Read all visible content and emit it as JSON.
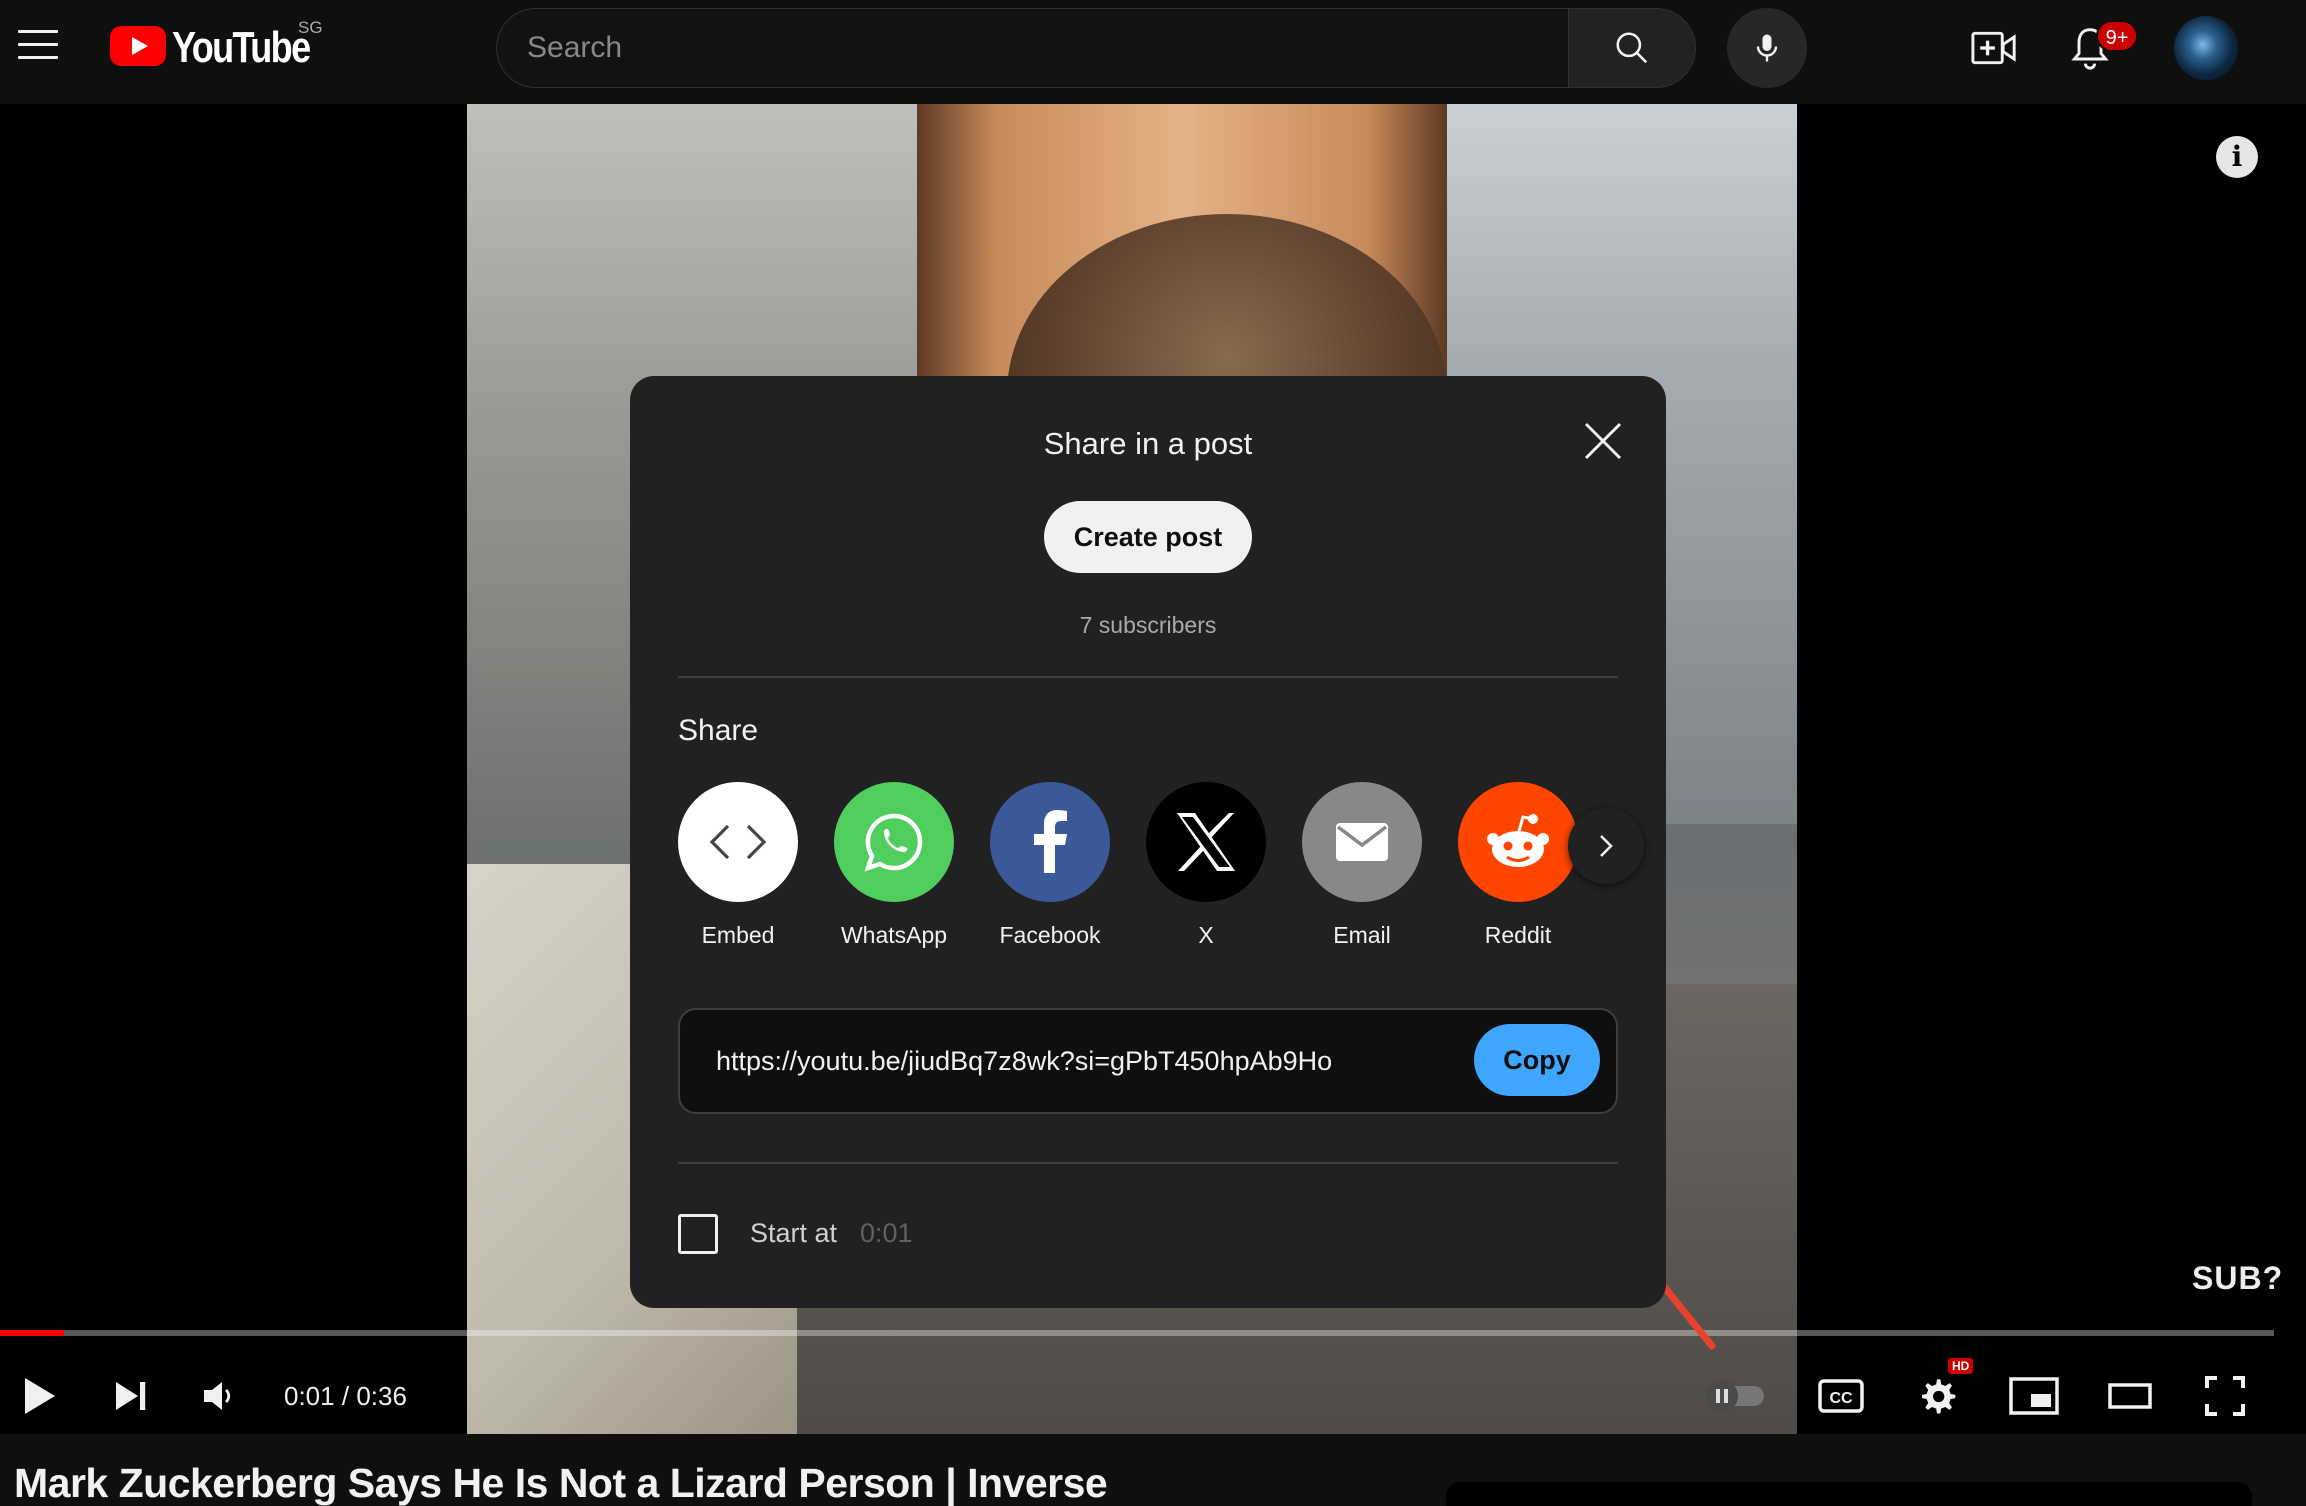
{
  "header": {
    "logo_text": "YouTube",
    "country_code": "SG",
    "search_placeholder": "Search",
    "notification_count": "9+"
  },
  "player": {
    "overlay_text": "SUB?",
    "time_current": "0:01",
    "time_separator": "/",
    "time_total": "0:36",
    "progress_fraction": 0.028,
    "hd_badge": "HD"
  },
  "share_dialog": {
    "title": "Share in a post",
    "create_post_label": "Create post",
    "subscribers": "7 subscribers",
    "share_label": "Share",
    "targets": [
      {
        "label": "Embed",
        "color": "#ffffff"
      },
      {
        "label": "WhatsApp",
        "color": "#25d366"
      },
      {
        "label": "Facebook",
        "color": "#3b5998"
      },
      {
        "label": "X",
        "color": "#000000"
      },
      {
        "label": "Email",
        "color": "#888888"
      },
      {
        "label": "Reddit",
        "color": "#ff4500"
      }
    ],
    "url": "https://youtu.be/jiudBq7z8wk?si=gPbT450hpAb9Ho",
    "copy_label": "Copy",
    "start_at_label": "Start at",
    "start_at_time": "0:01"
  },
  "video": {
    "title": "Mark Zuckerberg Says He Is Not a Lizard Person | Inverse"
  },
  "colors": {
    "accent_blue": "#3ea6ff",
    "brand_red": "#ff0000",
    "annotation_arrow": "#e8412f"
  }
}
